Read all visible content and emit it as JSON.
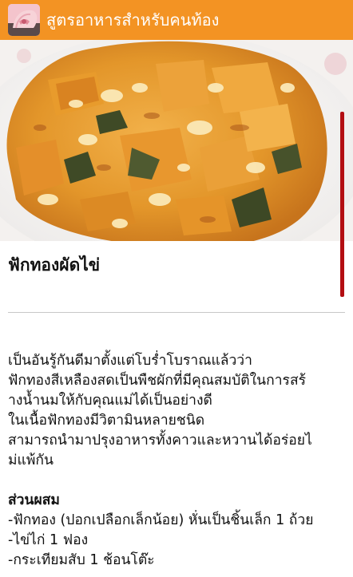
{
  "app_bar": {
    "title": "สูตรอาหารสำหรับคนท้อง",
    "icon": "pregnant-belly-app-icon",
    "color": "#f39323"
  },
  "hero_image": {
    "subject": "pumpkin-stir-fried-with-egg-photo"
  },
  "recipe": {
    "title": "ฟักทองผัดไข่",
    "intro_lines": [
      "เป็นอันรู้กันดีมาตั้งแต่โบร่ำโบราณแล้วว่า",
      "ฟักทองสีเหลืองสดเป็นพืชผักที่มีคุณสมบัติในการสร้",
      "างน้ำนมให้กับคุณแม่ได้เป็นอย่างดี",
      "ในเนื้อฟักทองมีวิตามินหลายชนิด",
      "สามารถนำมาปรุงอาหารทั้งคาวและหวานได้อร่อยไ",
      "ม่แพ้กัน"
    ],
    "ingredients_heading": "ส่วนผสม",
    "ingredients": [
      "-ฟักทอง (ปอกเปลือกเล็กน้อย) หั่นเป็นชิ้นเล็ก 1 ถ้วย",
      "-ไข่ไก่ 1 ฟอง",
      "-กระเทียมสับ 1 ช้อนโต๊ะ"
    ]
  },
  "colors": {
    "scroll_indicator": "#b30e12",
    "divider": "#c8c8c8"
  }
}
